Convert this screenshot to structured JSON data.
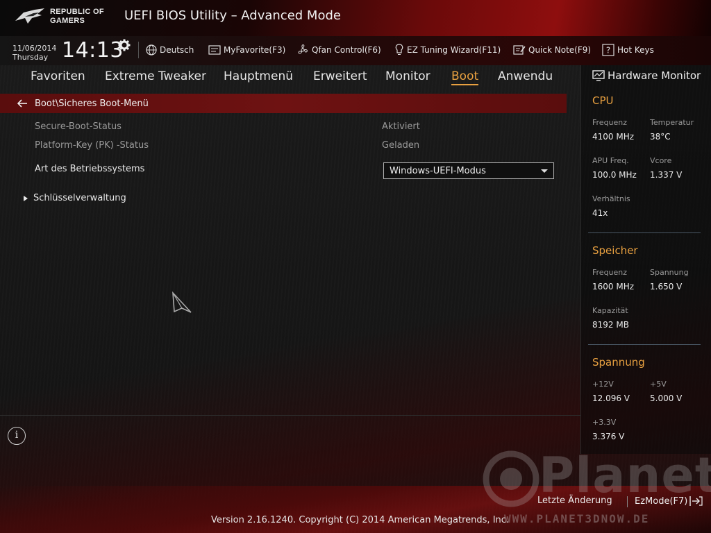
{
  "header": {
    "logo_line1": "REPUBLIC OF",
    "logo_line2": "GAMERS",
    "title": "UEFI BIOS Utility – Advanced Mode"
  },
  "toolbar": {
    "date": "11/06/2014",
    "weekday": "Thursday",
    "time": "14:13",
    "items": [
      {
        "label": "Deutsch",
        "icon": "globe-icon"
      },
      {
        "label": "MyFavorite(F3)",
        "icon": "favorite-icon"
      },
      {
        "label": "Qfan Control(F6)",
        "icon": "fan-icon"
      },
      {
        "label": "EZ Tuning Wizard(F11)",
        "icon": "lightbulb-icon"
      },
      {
        "label": "Quick Note(F9)",
        "icon": "note-icon"
      },
      {
        "label": "Hot Keys",
        "icon": "question-icon"
      }
    ]
  },
  "nav": {
    "tabs": [
      {
        "label": "Favoriten"
      },
      {
        "label": "Extreme Tweaker"
      },
      {
        "label": "Hauptmenü"
      },
      {
        "label": "Erweitert"
      },
      {
        "label": "Monitor"
      },
      {
        "label": "Boot"
      },
      {
        "label": "Anwendu"
      }
    ],
    "active": "Boot"
  },
  "breadcrumb": {
    "path": "Boot\\Sicheres Boot-Menü"
  },
  "settings": {
    "secure_boot_label": "Secure-Boot-Status",
    "secure_boot_value": "Aktiviert",
    "pk_label": "Platform-Key (PK) -Status",
    "pk_value": "Geladen",
    "os_label": "Art des Betriebssystems",
    "os_value": "Windows-UEFI-Modus",
    "submenu_label": "Schlüsselverwaltung"
  },
  "hardware_monitor": {
    "title": "Hardware Monitor",
    "cpu": {
      "heading": "CPU",
      "freq_label": "Frequenz",
      "freq_value": "4100 MHz",
      "temp_label": "Temperatur",
      "temp_value": "38°C",
      "apu_label": "APU Freq.",
      "apu_value": "100.0 MHz",
      "vcore_label": "Vcore",
      "vcore_value": "1.337 V",
      "ratio_label": "Verhältnis",
      "ratio_value": "41x"
    },
    "memory": {
      "heading": "Speicher",
      "freq_label": "Frequenz",
      "freq_value": "1600 MHz",
      "volt_label": "Spannung",
      "volt_value": "1.650 V",
      "cap_label": "Kapazität",
      "cap_value": "8192 MB"
    },
    "voltage": {
      "heading": "Spannung",
      "v12_label": "+12V",
      "v12_value": "12.096 V",
      "v5_label": "+5V",
      "v5_value": "5.000 V",
      "v33_label": "+3.3V",
      "v33_value": "3.376 V"
    }
  },
  "footer": {
    "last_change": "Letzte Änderung",
    "ezmode": "EzMode(F7)",
    "copyright": "Version 2.16.1240. Copyright (C) 2014 American Megatrends, Inc.",
    "watermark_brand": "Planet",
    "watermark_url": "WWW.PLANET3DNOW.DE"
  },
  "colors": {
    "accent": "#e8a040",
    "breadcrumb_bg": "#6e1212",
    "header_red": "#8e0e0e"
  }
}
